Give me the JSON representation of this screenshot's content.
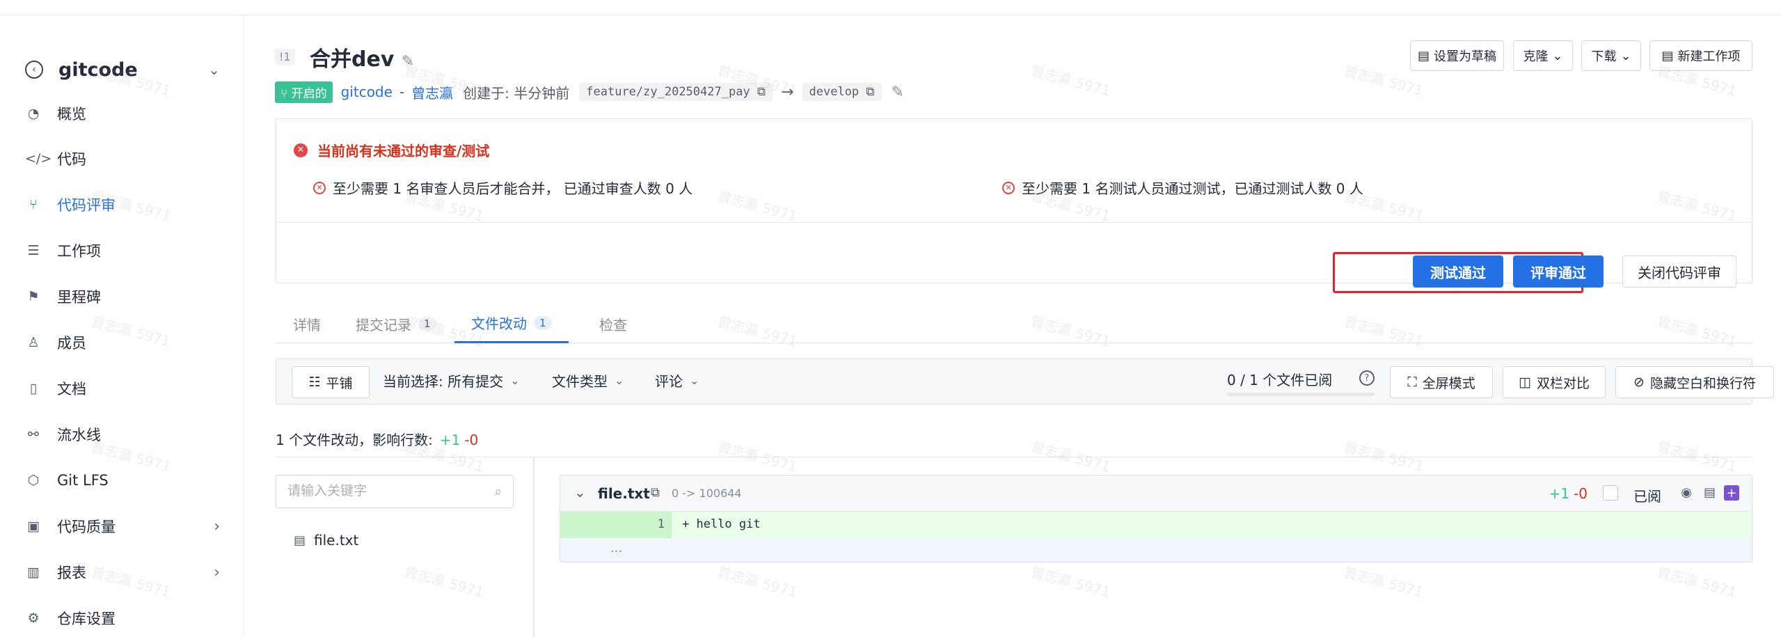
{
  "sidebar": {
    "repo_name": "gitcode",
    "items": [
      {
        "label": "概览"
      },
      {
        "label": "代码"
      },
      {
        "label": "代码评审"
      },
      {
        "label": "工作项"
      },
      {
        "label": "里程碑"
      },
      {
        "label": "成员"
      },
      {
        "label": "文档"
      },
      {
        "label": "流水线"
      },
      {
        "label": "Git LFS"
      },
      {
        "label": "代码质量"
      },
      {
        "label": "报表"
      },
      {
        "label": "仓库设置"
      }
    ]
  },
  "header": {
    "mr_id": "!1",
    "title": "合并dev",
    "status_badge": "开启的",
    "repo_link": "gitcode",
    "separator": "-",
    "author": "曾志瀛",
    "created": "创建于: 半分钟前",
    "source_branch": "feature/zy_20250427_pay",
    "arrow": "→",
    "target_branch": "develop",
    "actions": {
      "draft": "设置为草稿",
      "clone": "克隆",
      "download": "下载",
      "new_work_item": "新建工作项"
    }
  },
  "checks": {
    "warning_title": "当前尚有未通过的审查/测试",
    "review_requirement": "至少需要 1 名审查人员后才能合并， 已通过审查人数 0 人",
    "test_requirement": "至少需要 1 名测试人员通过测试，已通过测试人数 0 人",
    "test_pass_label": "测试通过",
    "review_pass_label": "评审通过",
    "close_label": "关闭代码评审"
  },
  "tabs": [
    {
      "label": "详情"
    },
    {
      "label": "提交记录",
      "count": "1"
    },
    {
      "label": "文件改动",
      "count": "1"
    },
    {
      "label": "检查"
    }
  ],
  "toolbar": {
    "flat_label": "平铺",
    "selection_label": "当前选择: 所有提交",
    "file_type_label": "文件类型",
    "comment_label": "评论",
    "viewed_progress": "0 / 1 个文件已阅",
    "viewed_fraction": 0,
    "fullscreen_label": "全屏模式",
    "side_by_side_label": "双栏对比",
    "hide_whitespace_label": "隐藏空白和换行符"
  },
  "summary": {
    "text": "1 个文件改动，影响行数:",
    "additions": "+1",
    "deletions": "-0"
  },
  "file_tree": {
    "search_placeholder": "请输入关键字",
    "files": [
      "file.txt"
    ]
  },
  "diff": {
    "file_name": "file.txt",
    "mode_change": "0 -> 100644",
    "additions": "+1",
    "deletions": "-0",
    "viewed_label": "已阅",
    "lines": [
      {
        "number": "1",
        "content": "+ hello git"
      }
    ],
    "fold": "..."
  },
  "watermark": "曾志瀛 5971",
  "colors": {
    "primary": "#2471e6",
    "success": "#3ac295",
    "danger": "#e02e18",
    "highlight_border": "#e8202a"
  }
}
